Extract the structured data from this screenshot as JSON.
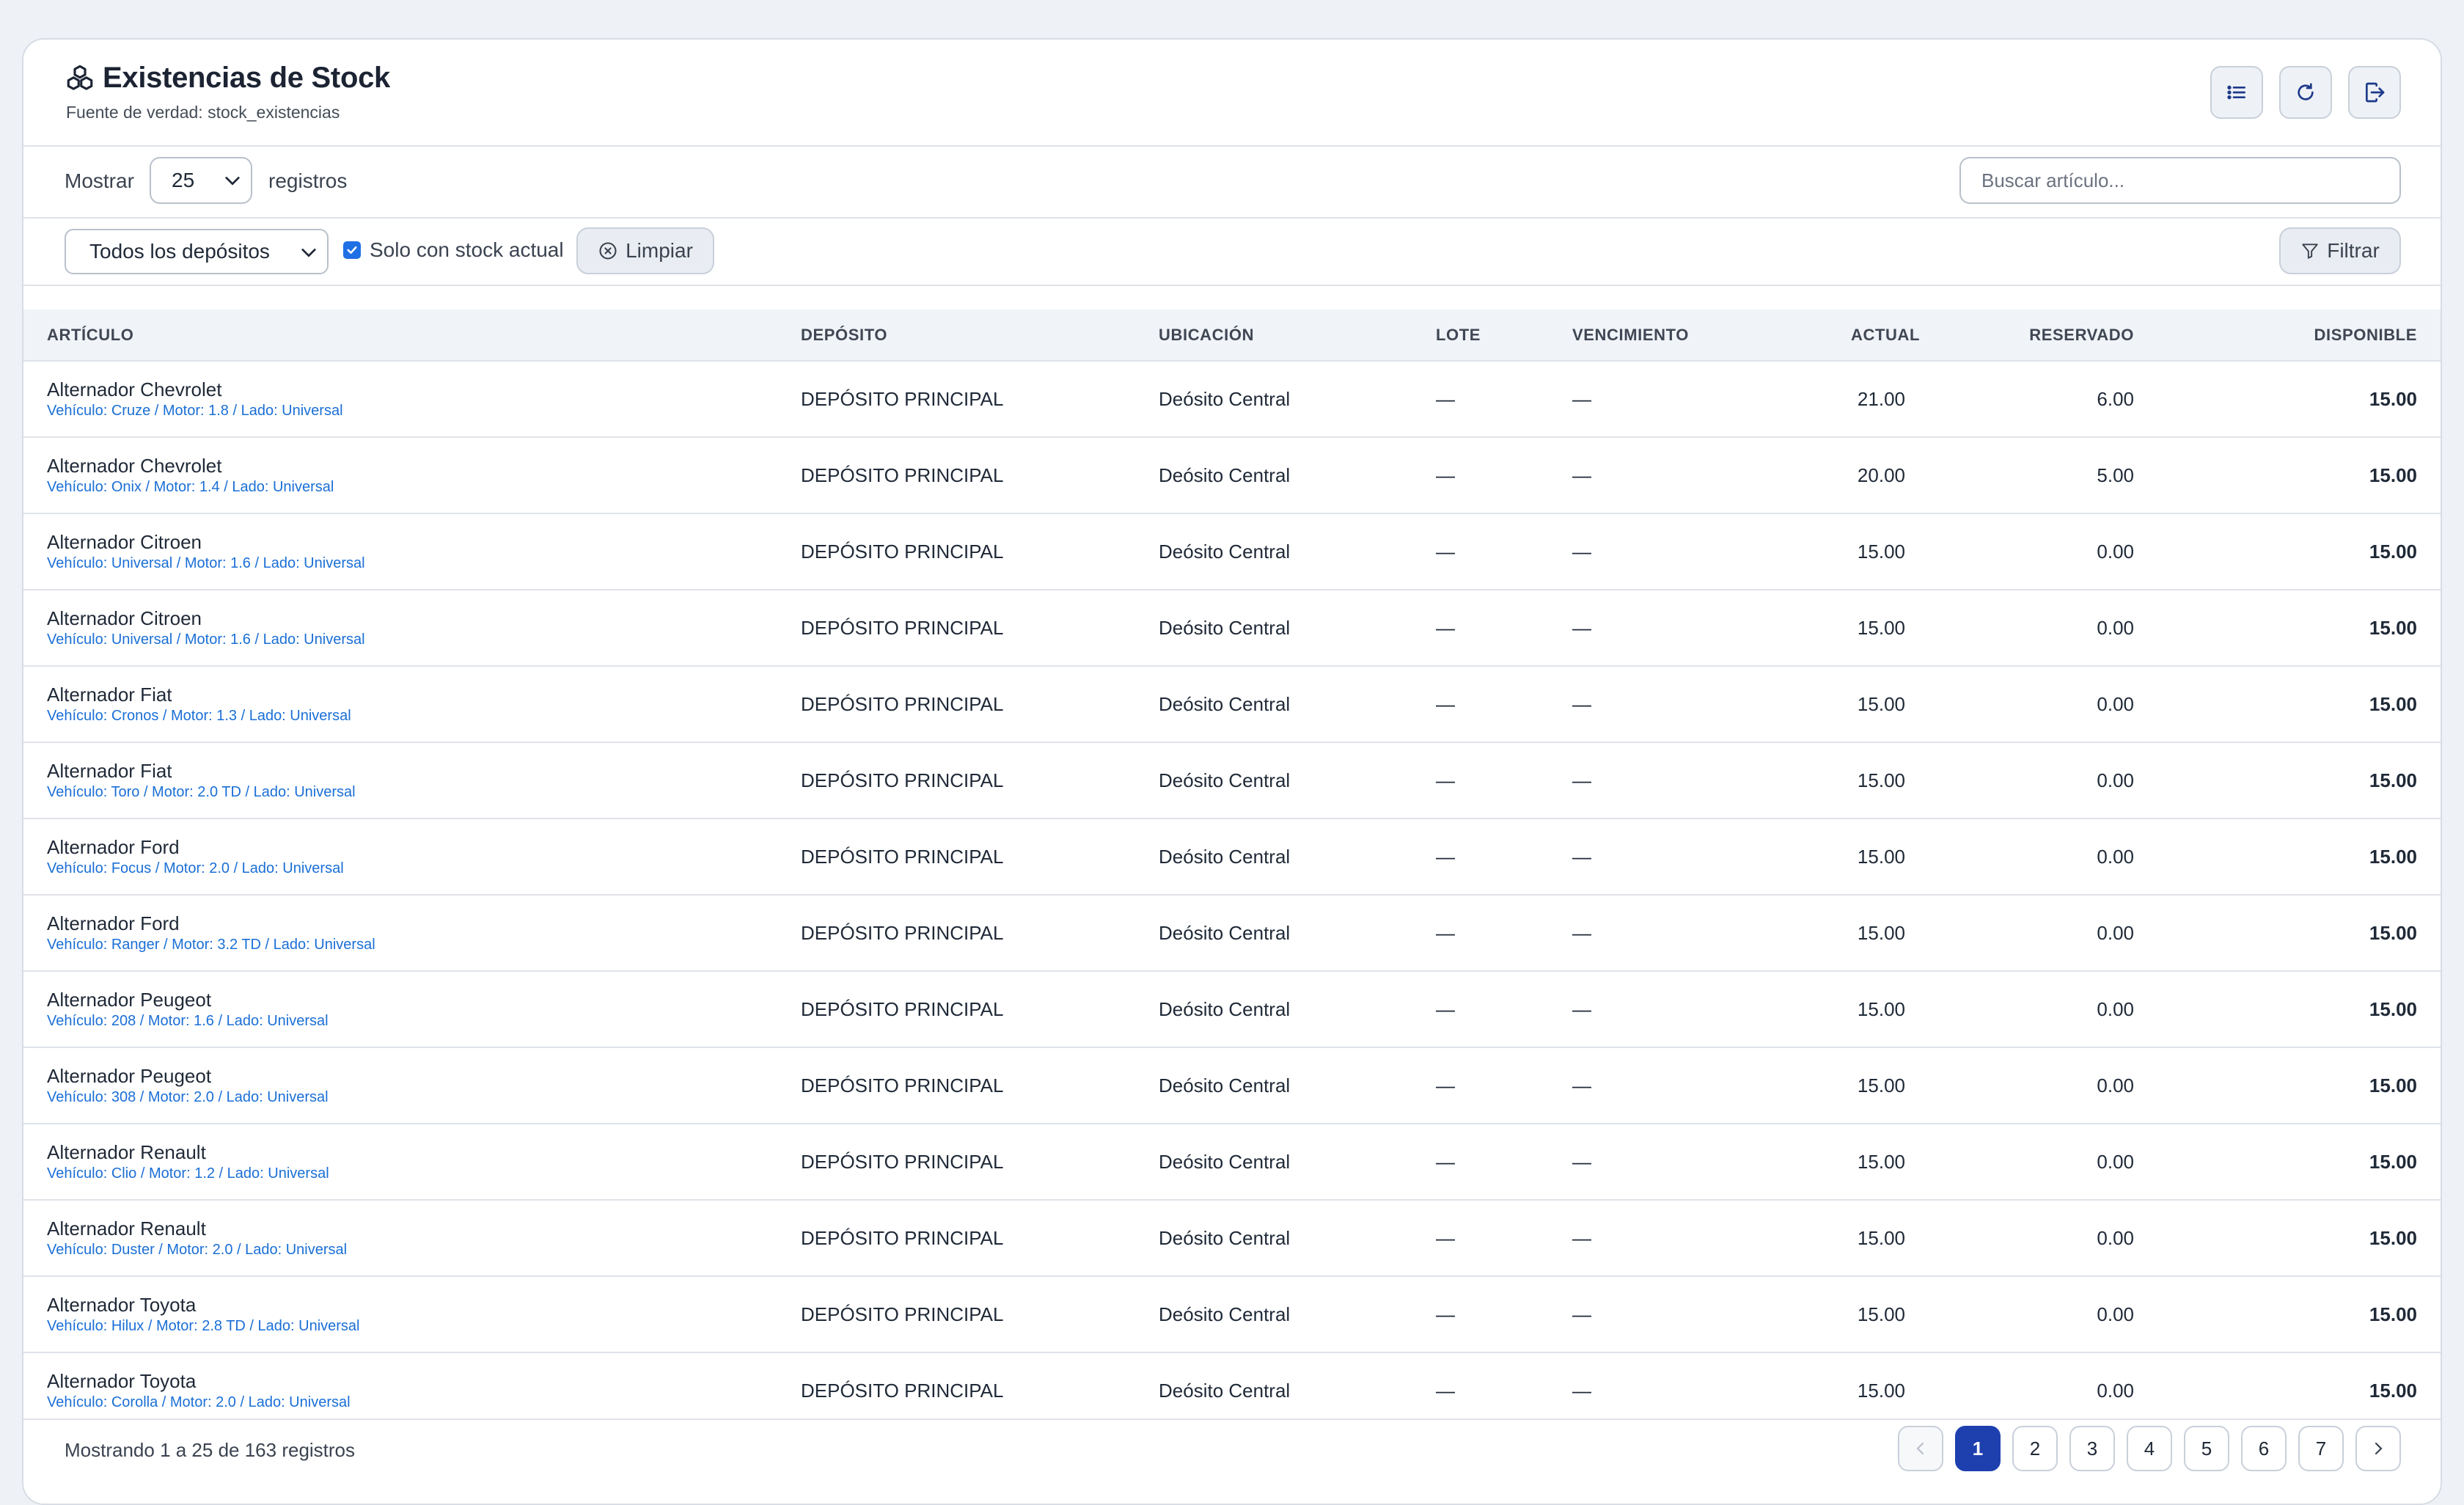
{
  "header": {
    "title": "Existencias de Stock",
    "subtitle": "Fuente de verdad: stock_existencias",
    "buttons": [
      "list-icon",
      "refresh-icon",
      "logout-icon"
    ]
  },
  "length": {
    "label": "Mostrar",
    "value": "25",
    "suffix": "registros"
  },
  "search": {
    "placeholder": "Buscar artículo..."
  },
  "filters": {
    "deposito": "Todos los depósitos",
    "solo_stock_label": "Solo con stock actual",
    "solo_stock_checked": true,
    "clear_label": "Limpiar",
    "filter_label": "Filtrar"
  },
  "table": {
    "columns": [
      "ARTÍCULO",
      "DEPÓSITO",
      "UBICACIÓN",
      "LOTE",
      "VENCIMIENTO",
      "ACTUAL",
      "RESERVADO",
      "DISPONIBLE"
    ],
    "rows": [
      {
        "name": "Alternador Chevrolet",
        "detail": "Vehículo: Cruze / Motor: 1.8 / Lado: Universal",
        "deposito": "DEPÓSITO PRINCIPAL",
        "ubicacion": "Deósito Central",
        "lote": "—",
        "vencimiento": "—",
        "actual": "21.00",
        "reservado": "6.00",
        "disponible": "15.00"
      },
      {
        "name": "Alternador Chevrolet",
        "detail": "Vehículo: Onix / Motor: 1.4 / Lado: Universal",
        "deposito": "DEPÓSITO PRINCIPAL",
        "ubicacion": "Deósito Central",
        "lote": "—",
        "vencimiento": "—",
        "actual": "20.00",
        "reservado": "5.00",
        "disponible": "15.00"
      },
      {
        "name": "Alternador Citroen",
        "detail": "Vehículo: Universal / Motor: 1.6 / Lado: Universal",
        "deposito": "DEPÓSITO PRINCIPAL",
        "ubicacion": "Deósito Central",
        "lote": "—",
        "vencimiento": "—",
        "actual": "15.00",
        "reservado": "0.00",
        "disponible": "15.00"
      },
      {
        "name": "Alternador Citroen",
        "detail": "Vehículo: Universal / Motor: 1.6 / Lado: Universal",
        "deposito": "DEPÓSITO PRINCIPAL",
        "ubicacion": "Deósito Central",
        "lote": "—",
        "vencimiento": "—",
        "actual": "15.00",
        "reservado": "0.00",
        "disponible": "15.00"
      },
      {
        "name": "Alternador Fiat",
        "detail": "Vehículo: Cronos / Motor: 1.3 / Lado: Universal",
        "deposito": "DEPÓSITO PRINCIPAL",
        "ubicacion": "Deósito Central",
        "lote": "—",
        "vencimiento": "—",
        "actual": "15.00",
        "reservado": "0.00",
        "disponible": "15.00"
      },
      {
        "name": "Alternador Fiat",
        "detail": "Vehículo: Toro / Motor: 2.0 TD / Lado: Universal",
        "deposito": "DEPÓSITO PRINCIPAL",
        "ubicacion": "Deósito Central",
        "lote": "—",
        "vencimiento": "—",
        "actual": "15.00",
        "reservado": "0.00",
        "disponible": "15.00"
      },
      {
        "name": "Alternador Ford",
        "detail": "Vehículo: Focus / Motor: 2.0 / Lado: Universal",
        "deposito": "DEPÓSITO PRINCIPAL",
        "ubicacion": "Deósito Central",
        "lote": "—",
        "vencimiento": "—",
        "actual": "15.00",
        "reservado": "0.00",
        "disponible": "15.00"
      },
      {
        "name": "Alternador Ford",
        "detail": "Vehículo: Ranger / Motor: 3.2 TD / Lado: Universal",
        "deposito": "DEPÓSITO PRINCIPAL",
        "ubicacion": "Deósito Central",
        "lote": "—",
        "vencimiento": "—",
        "actual": "15.00",
        "reservado": "0.00",
        "disponible": "15.00"
      },
      {
        "name": "Alternador Peugeot",
        "detail": "Vehículo: 208 / Motor: 1.6 / Lado: Universal",
        "deposito": "DEPÓSITO PRINCIPAL",
        "ubicacion": "Deósito Central",
        "lote": "—",
        "vencimiento": "—",
        "actual": "15.00",
        "reservado": "0.00",
        "disponible": "15.00"
      },
      {
        "name": "Alternador Peugeot",
        "detail": "Vehículo: 308 / Motor: 2.0 / Lado: Universal",
        "deposito": "DEPÓSITO PRINCIPAL",
        "ubicacion": "Deósito Central",
        "lote": "—",
        "vencimiento": "—",
        "actual": "15.00",
        "reservado": "0.00",
        "disponible": "15.00"
      },
      {
        "name": "Alternador Renault",
        "detail": "Vehículo: Clio / Motor: 1.2 / Lado: Universal",
        "deposito": "DEPÓSITO PRINCIPAL",
        "ubicacion": "Deósito Central",
        "lote": "—",
        "vencimiento": "—",
        "actual": "15.00",
        "reservado": "0.00",
        "disponible": "15.00"
      },
      {
        "name": "Alternador Renault",
        "detail": "Vehículo: Duster / Motor: 2.0 / Lado: Universal",
        "deposito": "DEPÓSITO PRINCIPAL",
        "ubicacion": "Deósito Central",
        "lote": "—",
        "vencimiento": "—",
        "actual": "15.00",
        "reservado": "0.00",
        "disponible": "15.00"
      },
      {
        "name": "Alternador Toyota",
        "detail": "Vehículo: Hilux / Motor: 2.8 TD / Lado: Universal",
        "deposito": "DEPÓSITO PRINCIPAL",
        "ubicacion": "Deósito Central",
        "lote": "—",
        "vencimiento": "—",
        "actual": "15.00",
        "reservado": "0.00",
        "disponible": "15.00"
      },
      {
        "name": "Alternador Toyota",
        "detail": "Vehículo: Corolla / Motor: 2.0 / Lado: Universal",
        "deposito": "DEPÓSITO PRINCIPAL",
        "ubicacion": "Deósito Central",
        "lote": "—",
        "vencimiento": "—",
        "actual": "15.00",
        "reservado": "0.00",
        "disponible": "15.00"
      }
    ]
  },
  "footer": {
    "info": "Mostrando 1 a 25 de 163 registros",
    "pages": [
      "1",
      "2",
      "3",
      "4",
      "5",
      "6",
      "7"
    ],
    "active_page": "1"
  },
  "colors": {
    "accent": "#1e40af",
    "link": "#1a6fd6",
    "checkbox": "#1f6fe5"
  }
}
